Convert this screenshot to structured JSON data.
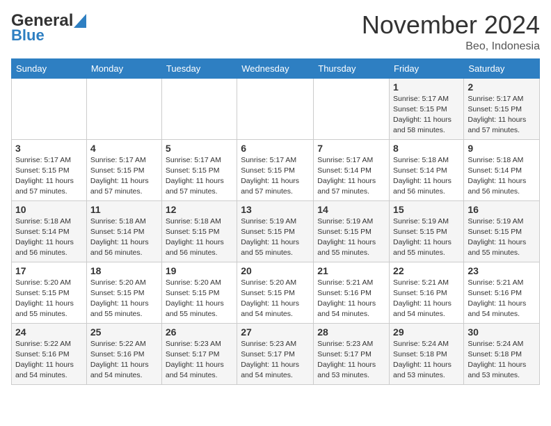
{
  "header": {
    "logo_general": "General",
    "logo_blue": "Blue",
    "month_title": "November 2024",
    "location": "Beo, Indonesia"
  },
  "days_of_week": [
    "Sunday",
    "Monday",
    "Tuesday",
    "Wednesday",
    "Thursday",
    "Friday",
    "Saturday"
  ],
  "weeks": [
    [
      {
        "day": "",
        "info": ""
      },
      {
        "day": "",
        "info": ""
      },
      {
        "day": "",
        "info": ""
      },
      {
        "day": "",
        "info": ""
      },
      {
        "day": "",
        "info": ""
      },
      {
        "day": "1",
        "info": "Sunrise: 5:17 AM\nSunset: 5:15 PM\nDaylight: 11 hours\nand 58 minutes."
      },
      {
        "day": "2",
        "info": "Sunrise: 5:17 AM\nSunset: 5:15 PM\nDaylight: 11 hours\nand 57 minutes."
      }
    ],
    [
      {
        "day": "3",
        "info": "Sunrise: 5:17 AM\nSunset: 5:15 PM\nDaylight: 11 hours\nand 57 minutes."
      },
      {
        "day": "4",
        "info": "Sunrise: 5:17 AM\nSunset: 5:15 PM\nDaylight: 11 hours\nand 57 minutes."
      },
      {
        "day": "5",
        "info": "Sunrise: 5:17 AM\nSunset: 5:15 PM\nDaylight: 11 hours\nand 57 minutes."
      },
      {
        "day": "6",
        "info": "Sunrise: 5:17 AM\nSunset: 5:15 PM\nDaylight: 11 hours\nand 57 minutes."
      },
      {
        "day": "7",
        "info": "Sunrise: 5:17 AM\nSunset: 5:14 PM\nDaylight: 11 hours\nand 57 minutes."
      },
      {
        "day": "8",
        "info": "Sunrise: 5:18 AM\nSunset: 5:14 PM\nDaylight: 11 hours\nand 56 minutes."
      },
      {
        "day": "9",
        "info": "Sunrise: 5:18 AM\nSunset: 5:14 PM\nDaylight: 11 hours\nand 56 minutes."
      }
    ],
    [
      {
        "day": "10",
        "info": "Sunrise: 5:18 AM\nSunset: 5:14 PM\nDaylight: 11 hours\nand 56 minutes."
      },
      {
        "day": "11",
        "info": "Sunrise: 5:18 AM\nSunset: 5:14 PM\nDaylight: 11 hours\nand 56 minutes."
      },
      {
        "day": "12",
        "info": "Sunrise: 5:18 AM\nSunset: 5:15 PM\nDaylight: 11 hours\nand 56 minutes."
      },
      {
        "day": "13",
        "info": "Sunrise: 5:19 AM\nSunset: 5:15 PM\nDaylight: 11 hours\nand 55 minutes."
      },
      {
        "day": "14",
        "info": "Sunrise: 5:19 AM\nSunset: 5:15 PM\nDaylight: 11 hours\nand 55 minutes."
      },
      {
        "day": "15",
        "info": "Sunrise: 5:19 AM\nSunset: 5:15 PM\nDaylight: 11 hours\nand 55 minutes."
      },
      {
        "day": "16",
        "info": "Sunrise: 5:19 AM\nSunset: 5:15 PM\nDaylight: 11 hours\nand 55 minutes."
      }
    ],
    [
      {
        "day": "17",
        "info": "Sunrise: 5:20 AM\nSunset: 5:15 PM\nDaylight: 11 hours\nand 55 minutes."
      },
      {
        "day": "18",
        "info": "Sunrise: 5:20 AM\nSunset: 5:15 PM\nDaylight: 11 hours\nand 55 minutes."
      },
      {
        "day": "19",
        "info": "Sunrise: 5:20 AM\nSunset: 5:15 PM\nDaylight: 11 hours\nand 55 minutes."
      },
      {
        "day": "20",
        "info": "Sunrise: 5:20 AM\nSunset: 5:15 PM\nDaylight: 11 hours\nand 54 minutes."
      },
      {
        "day": "21",
        "info": "Sunrise: 5:21 AM\nSunset: 5:16 PM\nDaylight: 11 hours\nand 54 minutes."
      },
      {
        "day": "22",
        "info": "Sunrise: 5:21 AM\nSunset: 5:16 PM\nDaylight: 11 hours\nand 54 minutes."
      },
      {
        "day": "23",
        "info": "Sunrise: 5:21 AM\nSunset: 5:16 PM\nDaylight: 11 hours\nand 54 minutes."
      }
    ],
    [
      {
        "day": "24",
        "info": "Sunrise: 5:22 AM\nSunset: 5:16 PM\nDaylight: 11 hours\nand 54 minutes."
      },
      {
        "day": "25",
        "info": "Sunrise: 5:22 AM\nSunset: 5:16 PM\nDaylight: 11 hours\nand 54 minutes."
      },
      {
        "day": "26",
        "info": "Sunrise: 5:23 AM\nSunset: 5:17 PM\nDaylight: 11 hours\nand 54 minutes."
      },
      {
        "day": "27",
        "info": "Sunrise: 5:23 AM\nSunset: 5:17 PM\nDaylight: 11 hours\nand 54 minutes."
      },
      {
        "day": "28",
        "info": "Sunrise: 5:23 AM\nSunset: 5:17 PM\nDaylight: 11 hours\nand 53 minutes."
      },
      {
        "day": "29",
        "info": "Sunrise: 5:24 AM\nSunset: 5:18 PM\nDaylight: 11 hours\nand 53 minutes."
      },
      {
        "day": "30",
        "info": "Sunrise: 5:24 AM\nSunset: 5:18 PM\nDaylight: 11 hours\nand 53 minutes."
      }
    ]
  ]
}
